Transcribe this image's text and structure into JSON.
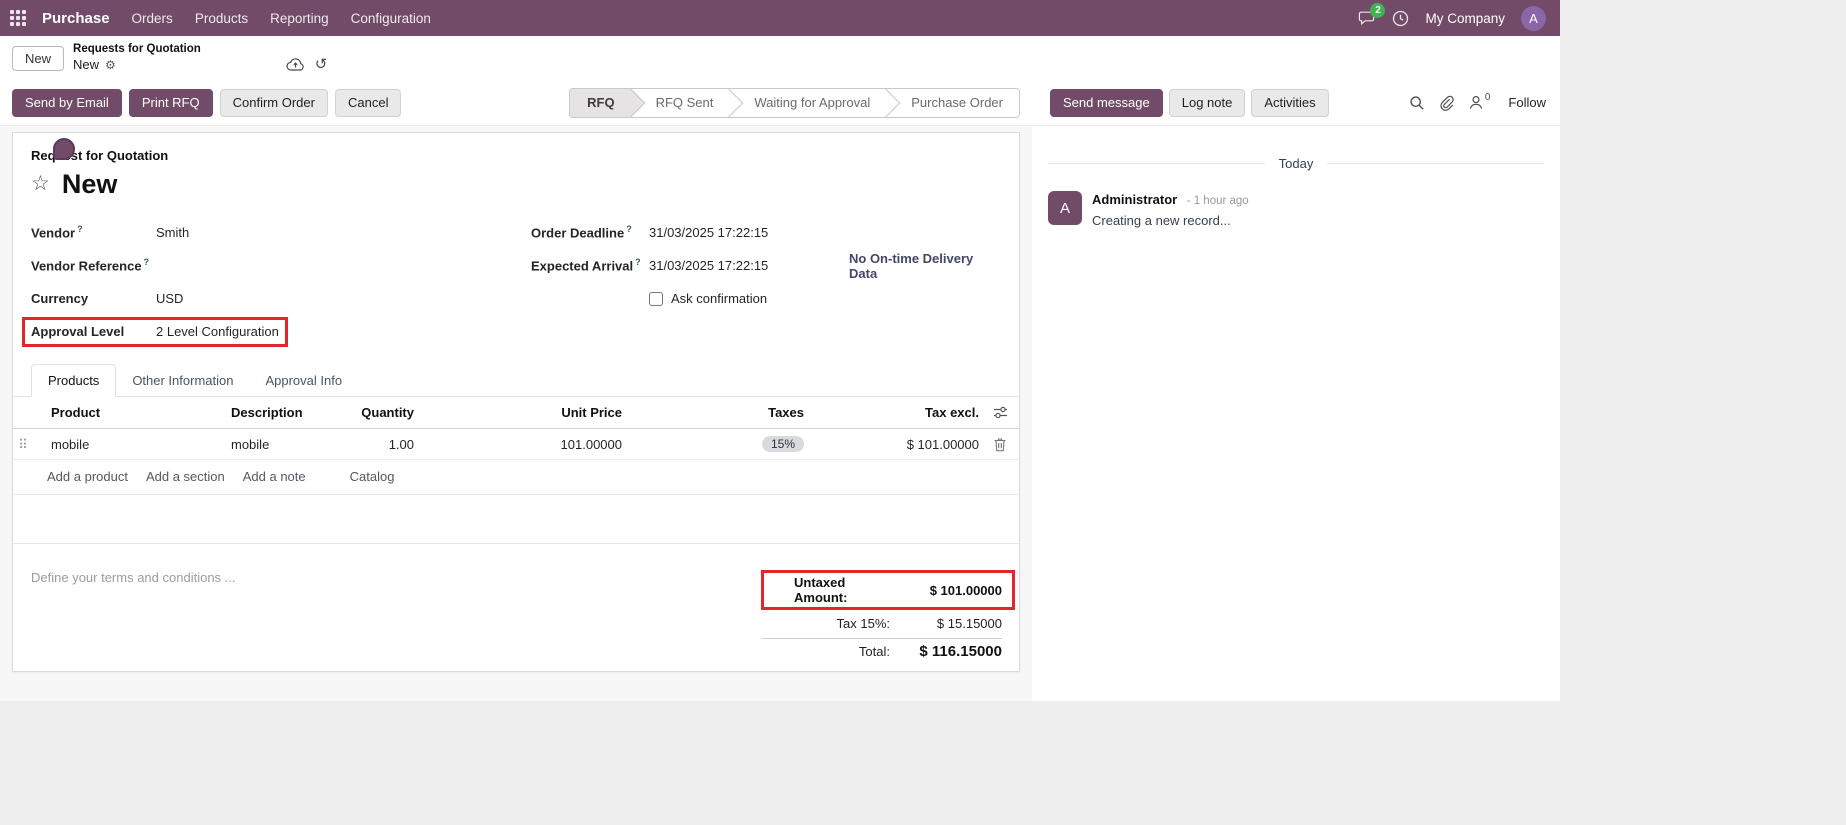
{
  "colors": {
    "brand": "#714B67",
    "highlight": "#E2262C",
    "badge_green": "#3EB34F"
  },
  "icons": {
    "gear": "⚙",
    "star": "☆",
    "undo": "↺",
    "drag_handle": "⠿"
  },
  "navbar": {
    "app_name": "Purchase",
    "menus": [
      "Orders",
      "Products",
      "Reporting",
      "Configuration"
    ],
    "message_count": "2",
    "company": "My Company",
    "user_initial": "A"
  },
  "breadcrumb": {
    "new_button": "New",
    "parent": "Requests for Quotation",
    "current": "New"
  },
  "control": {
    "buttons": [
      {
        "label": "Send by Email"
      },
      {
        "label": "Print RFQ"
      },
      {
        "label": "Confirm Order"
      },
      {
        "label": "Cancel"
      }
    ],
    "statusbar": [
      {
        "label": "RFQ",
        "active": true
      },
      {
        "label": "RFQ Sent",
        "active": false
      },
      {
        "label": "Waiting for Approval",
        "active": false
      },
      {
        "label": "Purchase Order",
        "active": false
      }
    ],
    "chatter_buttons": [
      {
        "label": "Send message"
      },
      {
        "label": "Log note"
      },
      {
        "label": "Activities"
      }
    ],
    "follower_count": "0",
    "follow_label": "Follow"
  },
  "form": {
    "doc_type": "Request for Quotation",
    "title": "New",
    "help_symbol": "?",
    "fields": {
      "vendor_label": "Vendor",
      "vendor_value": "Smith",
      "vendor_ref_label": "Vendor Reference",
      "vendor_ref_value": "",
      "currency_label": "Currency",
      "currency_value": "USD",
      "approval_label": "Approval Level",
      "approval_value": "2 Level Configuration",
      "deadline_label": "Order Deadline",
      "deadline_value": "31/03/2025 17:22:15",
      "arrival_label": "Expected Arrival",
      "arrival_value": "31/03/2025 17:22:15",
      "ontime_link": "No On-time Delivery Data",
      "ask_confirmation_label": "Ask confirmation",
      "ask_confirmation_checked": false
    },
    "tabs": [
      {
        "label": "Products",
        "active": true
      },
      {
        "label": "Other Information",
        "active": false
      },
      {
        "label": "Approval Info",
        "active": false
      }
    ],
    "table": {
      "headers": [
        "Product",
        "Description",
        "Quantity",
        "Unit Price",
        "Taxes",
        "Tax excl."
      ],
      "rows": [
        {
          "product": "mobile",
          "description": "mobile",
          "quantity": "1.00",
          "unit_price": "101.00000",
          "tax_badge": "15%",
          "tax_excl": "$ 101.00000"
        }
      ],
      "links": [
        "Add a product",
        "Add a section",
        "Add a note"
      ],
      "catalog": "Catalog"
    },
    "terms_placeholder": "Define your terms and conditions ...",
    "totals": {
      "untaxed_label": "Untaxed Amount:",
      "untaxed_value": "$ 101.00000",
      "tax_label": "Tax 15%:",
      "tax_value": "$ 15.15000",
      "total_label": "Total:",
      "total_value": "$ 116.15000"
    }
  },
  "chatter": {
    "date_divider": "Today",
    "author": "Administrator",
    "time": "- 1 hour ago",
    "body": "Creating a new record...",
    "avatar_initial": "A"
  }
}
